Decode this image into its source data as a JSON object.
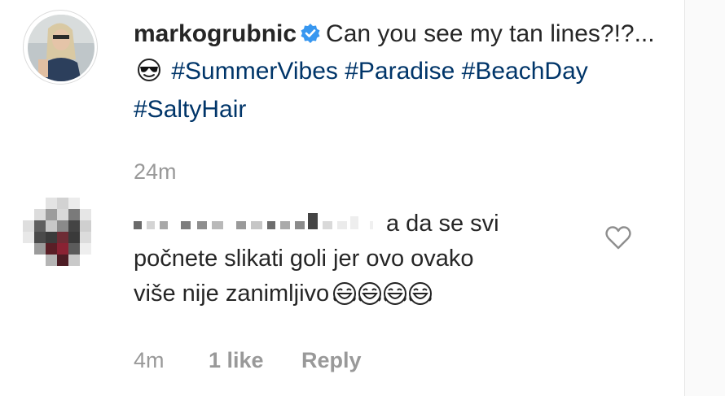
{
  "post": {
    "username": "markogrubnic",
    "caption_text": "Can you see my tan lines?!?...",
    "hashtags": [
      "#SummerVibes",
      "#Paradise",
      "#BeachDay",
      "#SaltyHair"
    ],
    "time": "24m",
    "emoji": "sunglasses-face-icon"
  },
  "comment": {
    "text_line1": "a da se svi",
    "text_line2": "počnete slikati goli jer ovo ovako",
    "text_line3": "više nije zanimljivo",
    "time": "4m",
    "likes": "1 like",
    "reply_label": "Reply",
    "emoji": "laughing-face-icon"
  },
  "colors": {
    "hashtag": "#003569",
    "verified": "#3897f0",
    "muted": "#999999",
    "text": "#262626"
  }
}
